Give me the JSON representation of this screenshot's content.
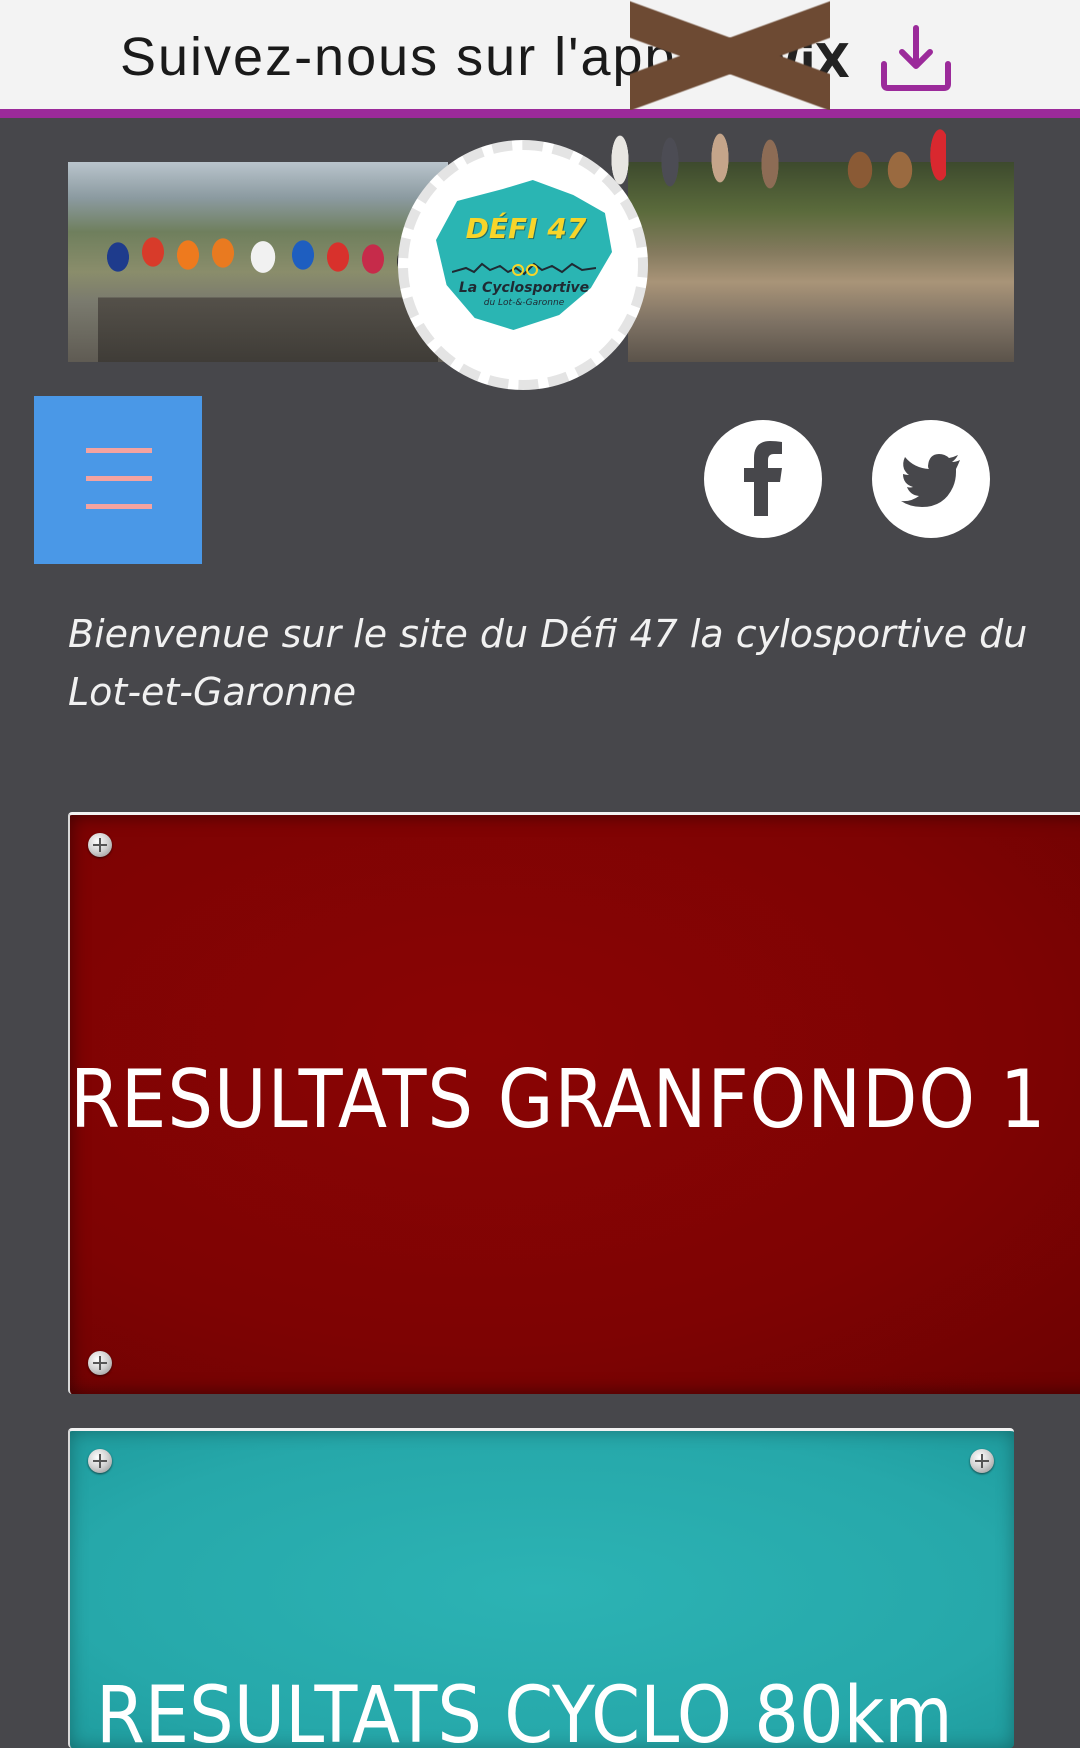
{
  "app_banner": {
    "text": "Suivez-nous sur l'appli",
    "brand": "WiX",
    "accent_color": "#9b2a9a",
    "download_icon": "download-icon"
  },
  "header": {
    "logo_title": "DÉFI 47",
    "logo_subtitle": "La Cyclosportive",
    "logo_subtitle_small": "du Lot-&-Garonne"
  },
  "nav": {
    "menu_icon": "hamburger-menu-icon",
    "menu_color": "#4a98e7"
  },
  "social": {
    "facebook_icon": "facebook-icon",
    "twitter_icon": "twitter-icon"
  },
  "main": {
    "welcome": "Bienvenue sur le site du Défi 47 la cylosportive du Lot-et-Garonne",
    "panels": [
      {
        "title": "RESULTATS GRANFONDO 1",
        "color": "#820303"
      },
      {
        "title": "RESULTATS CYCLO 80km",
        "color": "#2aafb0"
      }
    ]
  }
}
